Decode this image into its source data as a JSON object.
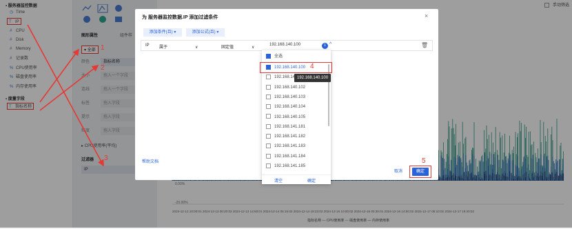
{
  "top_right_checkbox_label": "手动筛选",
  "fields_panel": {
    "measure_section": "服务器监控数据",
    "measures": [
      {
        "icon": "◷",
        "label": "Time"
      },
      {
        "icon": "T",
        "label": "IP"
      },
      {
        "icon": "#",
        "label": "CPU"
      },
      {
        "icon": "#",
        "label": "Disk"
      },
      {
        "icon": "#",
        "label": "Memory"
      },
      {
        "icon": "#",
        "label": "记录数"
      },
      {
        "icon": "%",
        "label": "CPU使用率"
      },
      {
        "icon": "%",
        "label": "磁盘使用率"
      },
      {
        "icon": "%",
        "label": "内存使用率"
      }
    ],
    "dim_section": "度量字段",
    "dims": [
      {
        "icon": "T",
        "label": "指标名称"
      }
    ]
  },
  "props_panel": {
    "title": "图形属性",
    "title2": "组件样",
    "all_label": "全部",
    "rows": [
      {
        "label": "颜色",
        "value": "指标名称"
      },
      {
        "label": "大小",
        "value": "拖入一个字段"
      },
      {
        "label": "连线",
        "value": "拖入一个字段"
      },
      {
        "label": "标签",
        "value": "拖入字段"
      },
      {
        "label": "提示",
        "value": "拖入字段"
      },
      {
        "label": "粒度",
        "value": "拖入字段"
      }
    ],
    "cpu_item": "CPU使用率(平均)",
    "filter_title": "过滤器",
    "filter_item": "IP"
  },
  "chart": {
    "y_labels": [
      "0.00%",
      "-20.00%"
    ],
    "x_axis_text": "2024-12-12 10:00:01 2024-12-13 00:20:02 2024-12-13 14:50:01 2024-12-14 05:15:02 2024-12-14 19:33:02 2024-12-15 10:00:02 2024-12-16 00:30:01 2024-12-16 14:50:02 2024-12-17 05:10:02 2024-12-17 19:30:02",
    "legend": [
      "指标名称",
      "CPU使用率",
      "磁盘使用率",
      "内存使用率"
    ],
    "colors": {
      "cpu": "#2b6cb8",
      "disk": "#2f9b86",
      "mem": "#1f3f7a"
    }
  },
  "dialog": {
    "title": "为 服务器监控数据.IP 添加过滤条件",
    "add_condition": "添加条件(且)",
    "add_formula": "添加公式(且)",
    "field": "IP",
    "operator": "属于",
    "mode": "固定值",
    "value": "192.168.140.100",
    "count": "1",
    "help": "帮助文档",
    "cancel": "取消",
    "confirm": "确定",
    "tooltip": "192.168.140.100"
  },
  "dropdown": {
    "select_all": "全选",
    "options": [
      "192.168.140.100",
      "192.168.140.101",
      "192.168.140.102",
      "192.168.140.103",
      "192.168.140.104",
      "192.168.140.105",
      "192.168.141.181",
      "192.168.141.182",
      "192.168.141.183",
      "192.168.141.184",
      "192.168.141.185"
    ],
    "checked": [
      true,
      false,
      false,
      false,
      false,
      false,
      false,
      false,
      false,
      false,
      false
    ],
    "clear": "清空",
    "ok": "确定"
  },
  "annotations": [
    "1",
    "2",
    "3",
    "4",
    "5"
  ]
}
